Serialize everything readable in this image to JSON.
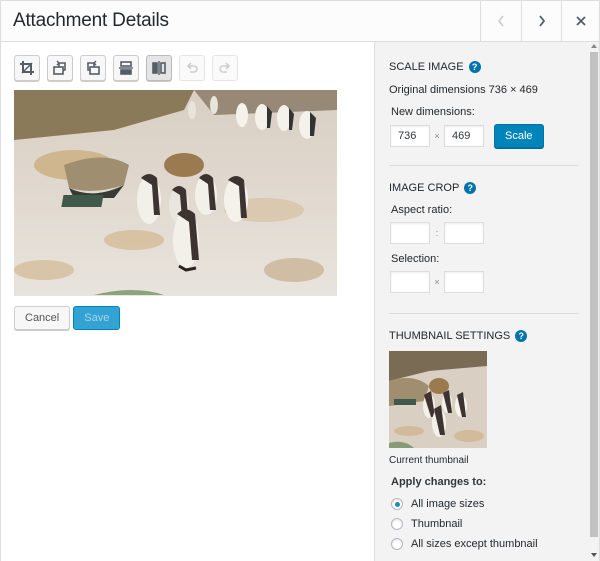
{
  "header": {
    "title": "Attachment Details",
    "prev_icon": "chevron-left-icon",
    "next_icon": "chevron-right-icon",
    "close_icon": "close-icon"
  },
  "toolbar": {
    "buttons": [
      {
        "name": "crop",
        "icon": "crop-icon",
        "state": "enabled"
      },
      {
        "name": "rotate-left",
        "icon": "rotate-left-icon",
        "state": "enabled"
      },
      {
        "name": "rotate-right",
        "icon": "rotate-right-icon",
        "state": "enabled"
      },
      {
        "name": "flip-vertical",
        "icon": "flip-vertical-icon",
        "state": "enabled"
      },
      {
        "name": "flip-horizontal",
        "icon": "flip-horizontal-icon",
        "state": "active"
      },
      {
        "name": "undo",
        "icon": "undo-icon",
        "state": "disabled"
      },
      {
        "name": "redo",
        "icon": "redo-icon",
        "state": "disabled"
      }
    ]
  },
  "preview": {
    "alt": "Penguins standing on rocky ground"
  },
  "actions": {
    "cancel_label": "Cancel",
    "save_label": "Save"
  },
  "scale_image": {
    "title": "Scale Image",
    "original_label": "Original dimensions 736 × 469",
    "new_dimensions_label": "New dimensions:",
    "width_value": "736",
    "height_value": "469",
    "separator": "×",
    "scale_button": "Scale"
  },
  "image_crop": {
    "title": "Image Crop",
    "aspect_ratio_label": "Aspect ratio:",
    "aspect_separator": ":",
    "aspect_w": "",
    "aspect_h": "",
    "selection_label": "Selection:",
    "selection_separator": "×",
    "selection_w": "",
    "selection_h": ""
  },
  "thumbnail_settings": {
    "title": "Thumbnail Settings",
    "current_thumbnail_label": "Current thumbnail",
    "apply_label": "Apply changes to:",
    "options": [
      {
        "label": "All image sizes",
        "checked": true
      },
      {
        "label": "Thumbnail",
        "checked": false
      },
      {
        "label": "All sizes except thumbnail",
        "checked": false
      }
    ]
  },
  "help_icon_text": "?",
  "colors": {
    "primary": "#0085ba",
    "help": "#0073aa",
    "sidebar_bg": "#f3f3f3"
  }
}
